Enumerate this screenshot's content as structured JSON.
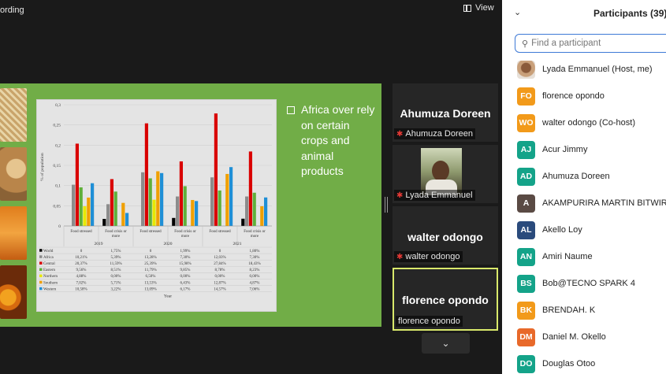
{
  "topbar": {
    "recording_text": "ording",
    "view_label": "View"
  },
  "slide": {
    "bullet": "Africa over rely on certain crops and animal products",
    "chart_data": {
      "type": "bar",
      "ylabel": "% of population",
      "ylim": [
        0,
        0.3
      ],
      "yticks": [
        "0",
        "0,05",
        "0,1",
        "0,15",
        "0,2",
        "0,25",
        "0,3"
      ],
      "xlabel": "Year",
      "categories": [
        "Food stressed",
        "Food crisis or more",
        "Food stressed",
        "Food crisis or more",
        "Food stressed",
        "Food crisis or more"
      ],
      "years": [
        "2019",
        "2020",
        "2021"
      ],
      "series": [
        {
          "name": "World",
          "color": "#000000",
          "values": [
            0,
            0.0175,
            0,
            0.0199,
            0,
            0.018
          ],
          "labels": [
            "0",
            "1,75%",
            "0",
            "1,99%",
            "0",
            "1,80%"
          ]
        },
        {
          "name": "Africa",
          "color": "#8c8c8c",
          "values": [
            0.1021,
            0.0539,
            0.1328,
            0.073,
            0.1203,
            0.073
          ],
          "labels": [
            "10,21%",
            "5,39%",
            "13,28%",
            "7,30%",
            "12,03%",
            "7,30%"
          ]
        },
        {
          "name": "Central",
          "color": "#d90000",
          "values": [
            0.2037,
            0.1159,
            0.2539,
            0.1598,
            0.2784,
            0.1843
          ],
          "labels": [
            "20,37%",
            "11,59%",
            "25,39%",
            "15,98%",
            "27,84%",
            "18,43%"
          ]
        },
        {
          "name": "Eastern",
          "color": "#5fb03a",
          "values": [
            0.0956,
            0.0851,
            0.1179,
            0.0985,
            0.0878,
            0.0823
          ],
          "labels": [
            "9,56%",
            "8,51%",
            "11,79%",
            "9,85%",
            "8,78%",
            "8,23%"
          ]
        },
        {
          "name": "Northern",
          "color": "#e8e800",
          "values": [
            0.0488,
            0,
            0.065,
            0,
            0,
            0
          ],
          "labels": [
            "4,88%",
            "0,00%",
            "6,50%",
            "0,00%",
            "0,00%",
            "0,00%"
          ]
        },
        {
          "name": "Southern",
          "color": "#f0a000",
          "values": [
            0.0702,
            0.0571,
            0.1353,
            0.0643,
            0.1287,
            0.0487
          ],
          "labels": [
            "7,02%",
            "5,71%",
            "13,53%",
            "6,43%",
            "12,87%",
            "4,87%"
          ]
        },
        {
          "name": "Western",
          "color": "#1f8fd6",
          "values": [
            0.1058,
            0.0322,
            0.1309,
            0.0617,
            0.1457,
            0.0706
          ],
          "labels": [
            "10,58%",
            "3,22%",
            "13,09%",
            "6,17%",
            "14,57%",
            "7,06%"
          ]
        }
      ]
    }
  },
  "tiles": [
    {
      "big": "Ahumuza Doreen",
      "tag": "Ahumuza Doreen",
      "muted": true
    },
    {
      "big": "",
      "tag": "Lyada Emmanuel",
      "muted": true
    },
    {
      "big": "walter odongo",
      "tag": "walter odongo",
      "muted": true
    },
    {
      "big": "florence opondo",
      "tag": "florence opondo",
      "muted": false
    }
  ],
  "panel": {
    "title": "Participants (39)",
    "search_placeholder": "Find a participant",
    "participants": [
      {
        "initials": "",
        "name": "Lyada Emmanuel (Host, me)",
        "color": ""
      },
      {
        "initials": "FO",
        "name": "florence opondo",
        "color": "#f29a1a"
      },
      {
        "initials": "WO",
        "name": "walter odongo (Co-host)",
        "color": "#f29a1a"
      },
      {
        "initials": "AJ",
        "name": "Acur Jimmy",
        "color": "#14a389"
      },
      {
        "initials": "AD",
        "name": "Ahumuza Doreen",
        "color": "#14a389"
      },
      {
        "initials": "A",
        "name": "AKAMPURIRA MARTIN BITWIRE",
        "color": "#5a4a44"
      },
      {
        "initials": "AL",
        "name": "Akello Loy",
        "color": "#2a4b7c"
      },
      {
        "initials": "AN",
        "name": "Amiri Naume",
        "color": "#14a389"
      },
      {
        "initials": "BS",
        "name": "Bob@TECNO SPARK 4",
        "color": "#14a389"
      },
      {
        "initials": "BK",
        "name": "BRENDAH. K",
        "color": "#f29a1a"
      },
      {
        "initials": "DM",
        "name": "Daniel M. Okello",
        "color": "#e8692a"
      },
      {
        "initials": "DO",
        "name": "Douglas Otoo",
        "color": "#14a389"
      }
    ]
  }
}
